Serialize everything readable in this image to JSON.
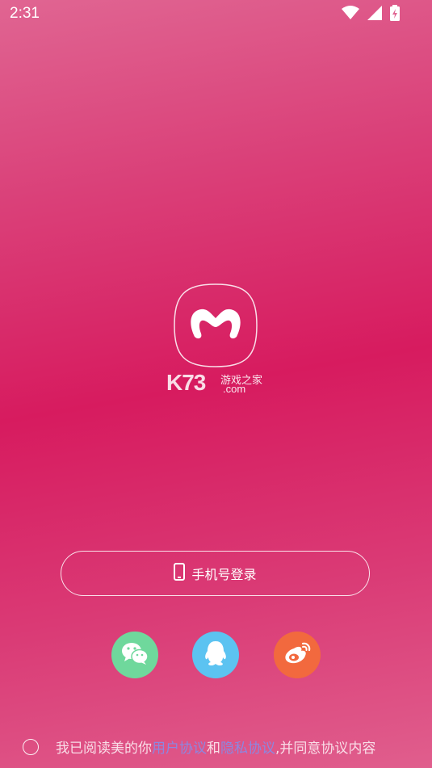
{
  "status_bar": {
    "time": "2:31",
    "icons": [
      "wifi-icon",
      "signal-icon",
      "battery-charging-icon"
    ]
  },
  "logo": {
    "icon": "app-logo-m-icon",
    "watermark_k73": "K73",
    "watermark_cn": "游戏之家",
    "watermark_com": ".com"
  },
  "login": {
    "phone_label": "手机号登录",
    "phone_icon": "phone-icon"
  },
  "social": {
    "items": [
      "wechat-icon",
      "qq-icon",
      "weibo-icon"
    ],
    "colors": {
      "wechat": "#6fd89c",
      "qq": "#5cc3f1",
      "weibo": "#f2693e"
    }
  },
  "agreement": {
    "prefix": "我已阅读美的你",
    "user_agreement": "用户协议",
    "and": "和",
    "privacy_policy": "隐私协议",
    "suffix": ",并同意协议内容"
  },
  "colors": {
    "background": "#d71b5f",
    "link": "#8c87e0"
  }
}
